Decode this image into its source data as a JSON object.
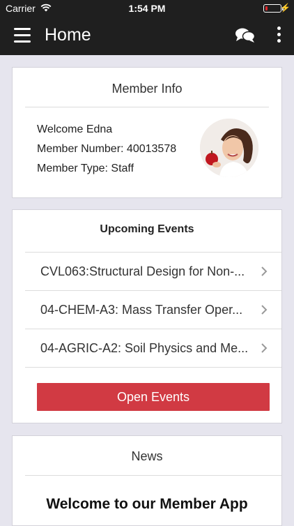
{
  "status_bar": {
    "carrier": "Carrier",
    "time": "1:54 PM",
    "battery_level": 0.15,
    "battery_color": "#e0252a"
  },
  "app_bar": {
    "title": "Home",
    "icons": [
      "menu-icon",
      "chat-bubbles-icon",
      "more-vertical-icon"
    ]
  },
  "member_info": {
    "title": "Member Info",
    "welcome": "Welcome Edna",
    "member_number": "Member Number: 40013578",
    "member_type": "Member Type: Staff"
  },
  "upcoming_events": {
    "title": "Upcoming Events",
    "items": [
      {
        "label": "CVL063:Structural Design for Non-..."
      },
      {
        "label": "04-CHEM-A3: Mass Transfer Oper..."
      },
      {
        "label": "04-AGRIC-A2: Soil Physics and Me..."
      }
    ],
    "button_label": "Open Events",
    "button_color": "#d13a43"
  },
  "news": {
    "title": "News",
    "headline": "Welcome to our Member App"
  }
}
